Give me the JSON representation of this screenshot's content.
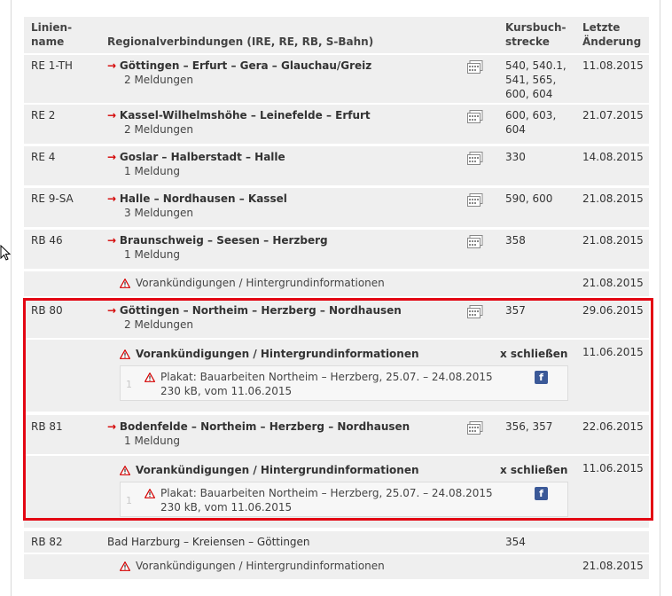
{
  "header": {
    "col_line": "Linien-\nname",
    "col_route": "Regionalverbindungen (IRE, RE, RB, S-Bahn)",
    "col_kbs": "Kursbuch-\nstrecke",
    "col_changed": "Letzte\nÄnderung"
  },
  "rows": [
    {
      "line": "RE 1-TH",
      "route": "Göttingen – Erfurt – Gera – Glauchau/Greiz",
      "messages": "2 Meldungen",
      "kbs": "540, 540.1,\n541, 565,\n600, 604",
      "date": "11.08.2015"
    },
    {
      "line": "RE 2",
      "route": "Kassel-Wilhelmshöhe – Leinefelde – Erfurt",
      "messages": "2 Meldungen",
      "kbs": "600, 603,\n604",
      "date": "21.07.2015"
    },
    {
      "line": "RE 4",
      "route": "Goslar – Halberstadt – Halle",
      "messages": "1 Meldung",
      "kbs": "330",
      "date": "14.08.2015"
    },
    {
      "line": "RE 9-SA",
      "route": "Halle – Nordhausen – Kassel",
      "messages": "3 Meldungen",
      "kbs": "590, 600",
      "date": "21.08.2015"
    },
    {
      "line": "RB 46",
      "route": "Braunschweig – Seesen – Herzberg",
      "messages": "1 Meldung",
      "kbs": "358",
      "date": "21.08.2015"
    },
    {
      "line": "RB 80",
      "route": "Göttingen – Northeim – Herzberg – Nordhausen",
      "messages": "2 Meldungen",
      "kbs": "357",
      "date": "29.06.2015"
    },
    {
      "line": "RB 81",
      "route": "Bodenfelde – Northeim – Herzberg – Nordhausen",
      "messages": "1 Meldung",
      "kbs": "356, 357",
      "date": "22.06.2015"
    },
    {
      "line": "RB 82",
      "route": "Bad Harzburg – Kreiensen – Göttingen",
      "kbs": "354"
    }
  ],
  "notices": {
    "collapsed_label": "Vorankündigungen / Hintergrundinformationen",
    "collapsed_date_1": "21.08.2015",
    "collapsed_date_2": "21.08.2015",
    "expanded_label": "Vorankündigungen / Hintergrundinformationen",
    "close_label": "x schließen",
    "expanded_date_1": "11.06.2015",
    "expanded_date_2": "11.06.2015",
    "item_index": "1",
    "item_title": "Plakat: Bauarbeiten Northeim – Herzberg, 25.07. – 24.08.2015",
    "item_meta": "230 kB, vom 11.06.2015",
    "fb_glyph": "f"
  },
  "colors": {
    "accent": "#d40000",
    "highlight": "#e30613",
    "facebook": "#3b5998"
  }
}
